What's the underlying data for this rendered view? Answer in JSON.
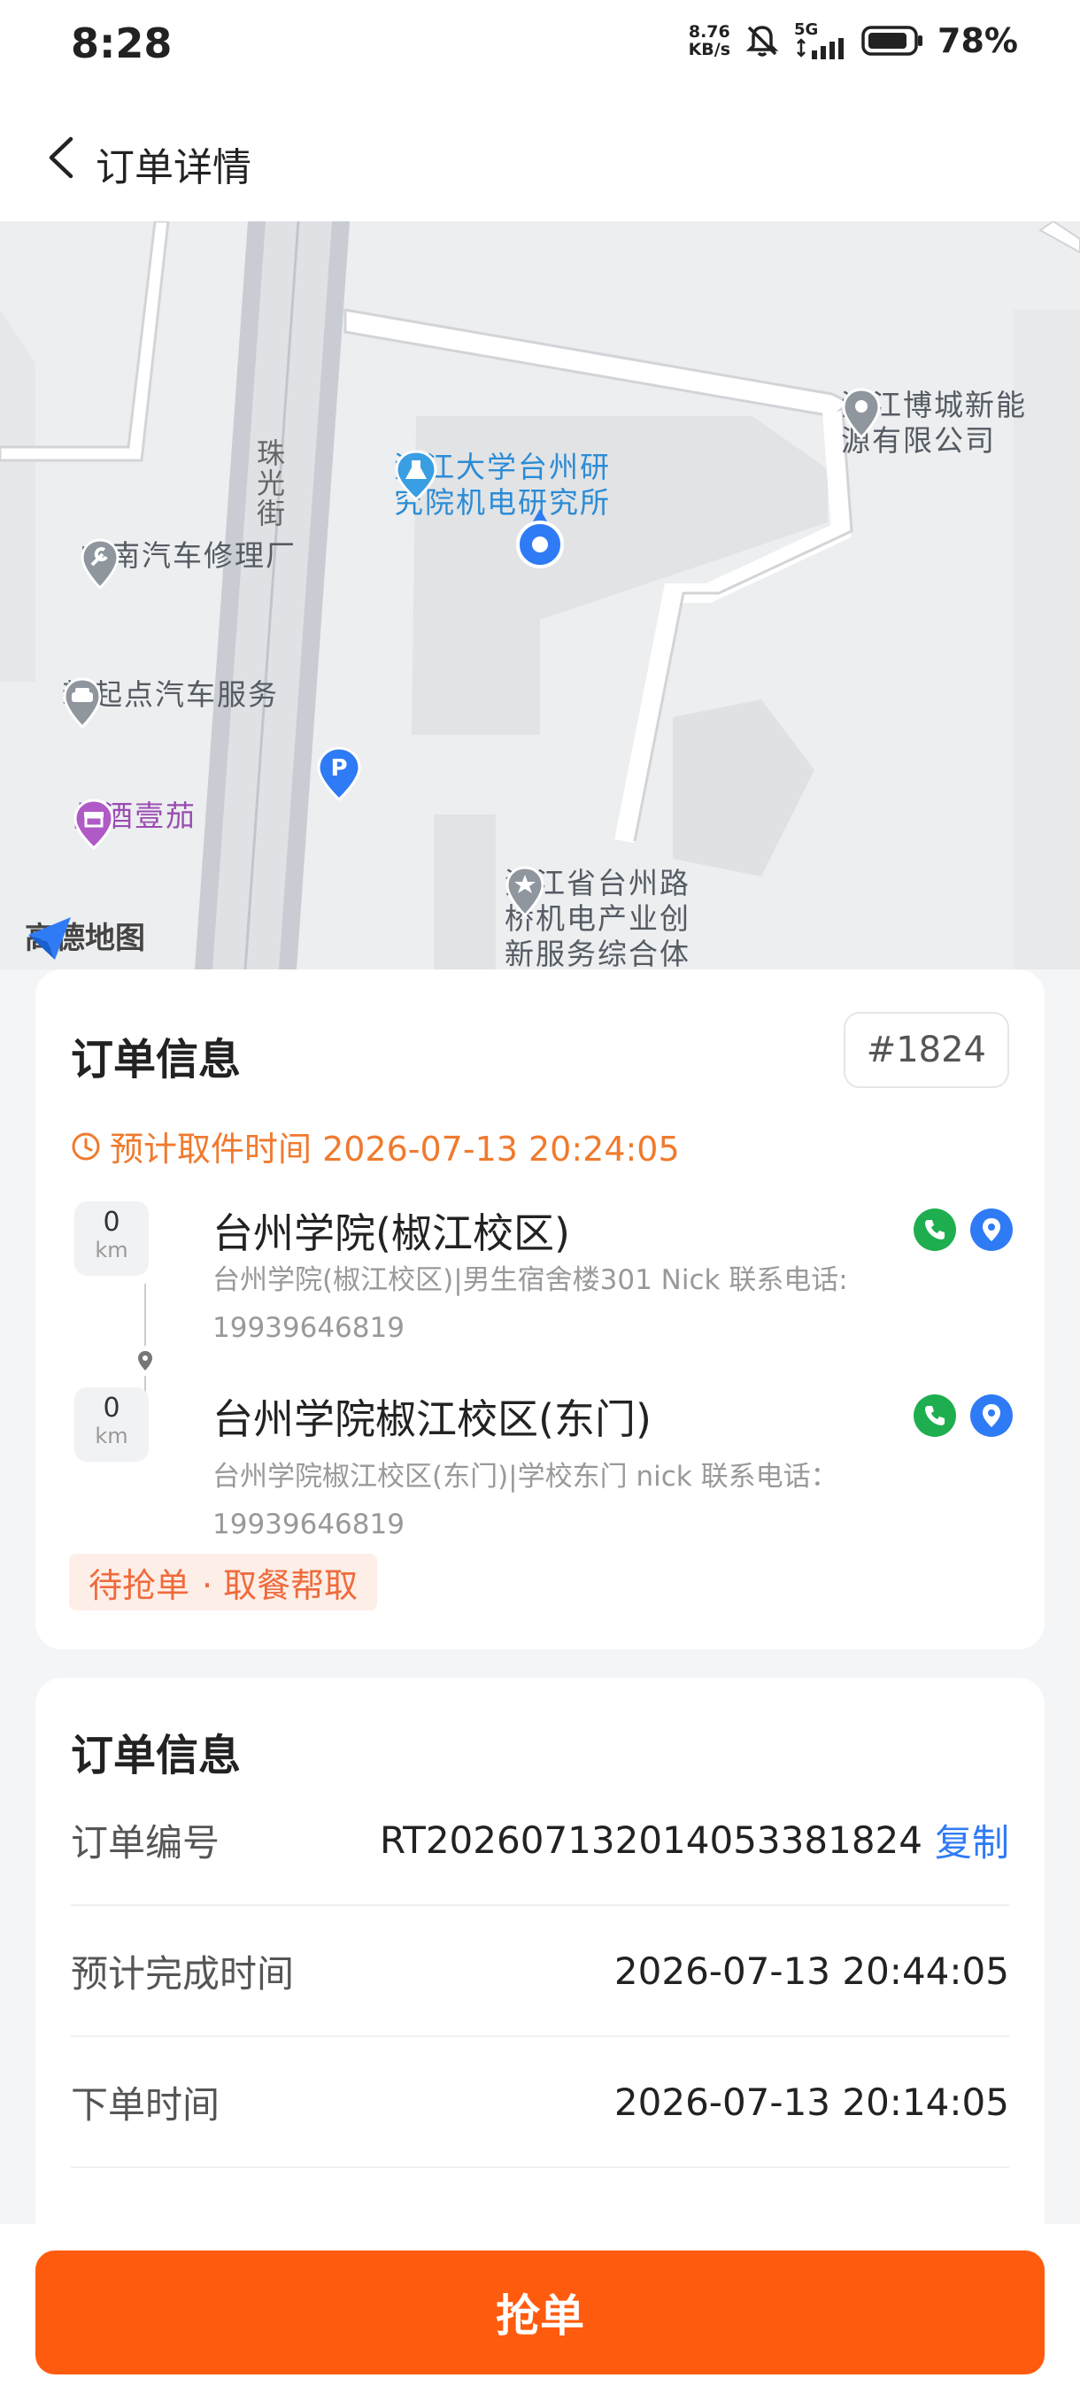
{
  "status_bar": {
    "time": "8:28",
    "net_speed_value": "8.76",
    "net_speed_unit": "KB/s",
    "network": "5G",
    "battery": "78%"
  },
  "header": {
    "title": "订单详情"
  },
  "map": {
    "street": "珠光街",
    "pois": [
      {
        "name": "浙江博城新能源有限公司",
        "line1": "浙江博城新能",
        "line2": "源有限公司"
      },
      {
        "name": "浙江大学台州研究院机电研究所",
        "line1": "浙江大学台州研",
        "line2": "究院机电研究所"
      },
      {
        "name": "中南汽车修理厂"
      },
      {
        "name": "新起点汽车服务"
      },
      {
        "name": "品酒壹茄"
      },
      {
        "name": "浙江省台州路桥机电产业创新服务综合体",
        "line1": "浙江省台州路",
        "line2": "桥机电产业创",
        "line3": "新服务综合体"
      }
    ],
    "logo": "高德地图"
  },
  "order_card": {
    "title": "订单信息",
    "order_tag": "#1824",
    "pickup_time": "预计取件时间 2026-07-13 20:24:05",
    "stops": [
      {
        "distance": "0",
        "unit": "km",
        "name": "台州学院(椒江校区)",
        "address_line1": "台州学院(椒江校区)|男生宿舍楼301 Nick 联系电话:",
        "address_line2": "19939646819"
      },
      {
        "distance": "0",
        "unit": "km",
        "name": "台州学院椒江校区(东门)",
        "address_line1": "台州学院椒江校区(东门)|学校东门 nick 联系电话：19939646819"
      }
    ],
    "status": "待抢单",
    "category": "· 取餐帮取"
  },
  "info_card": {
    "title": "订单信息",
    "rows": [
      {
        "label": "订单编号",
        "value": "RT20260713201405338​1824",
        "action": "复制"
      },
      {
        "label": "预计完成时间",
        "value": "2026-07-13 20:44:05"
      },
      {
        "label": "下单时间",
        "value": "2026-07-13 20:14:05"
      }
    ]
  },
  "bottom": {
    "button": "抢单"
  },
  "colors": {
    "accent": "#ff5b0e",
    "warning": "#f07a2e",
    "link": "#2f7bf5",
    "call": "#1fae4f"
  }
}
